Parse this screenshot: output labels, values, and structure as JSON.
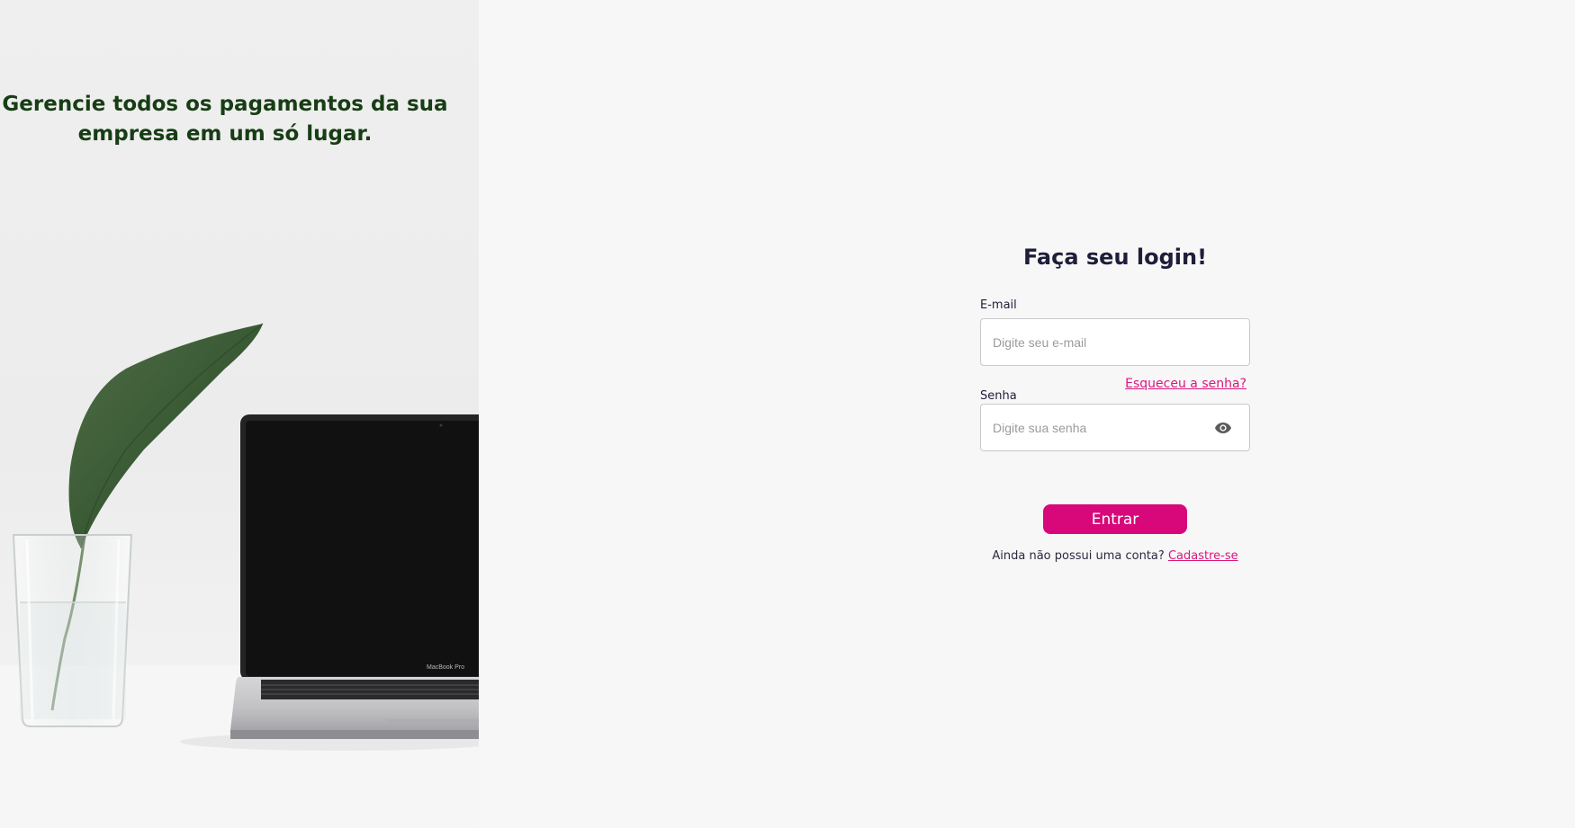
{
  "hero": {
    "headline": "Gerencie todos os pagamentos da sua\nempresa em um só lugar.",
    "laptop_brand": "MacBook Pro"
  },
  "login": {
    "title": "Faça seu login!",
    "email_label": "E-mail",
    "email_placeholder": "Digite seu e-mail",
    "password_label": "Senha",
    "password_placeholder": "Digite sua senha",
    "forgot_password": "Esqueceu a senha?",
    "submit_label": "Entrar",
    "no_account_text": "Ainda não possui uma conta?",
    "signup_link": "Cadastre-se"
  },
  "colors": {
    "accent": "#d8087a",
    "link": "#d9177e",
    "headline": "#173d14",
    "title": "#1e1e3a",
    "background": "#f7f7f7"
  },
  "icons": {
    "password_toggle": "eye-icon"
  }
}
